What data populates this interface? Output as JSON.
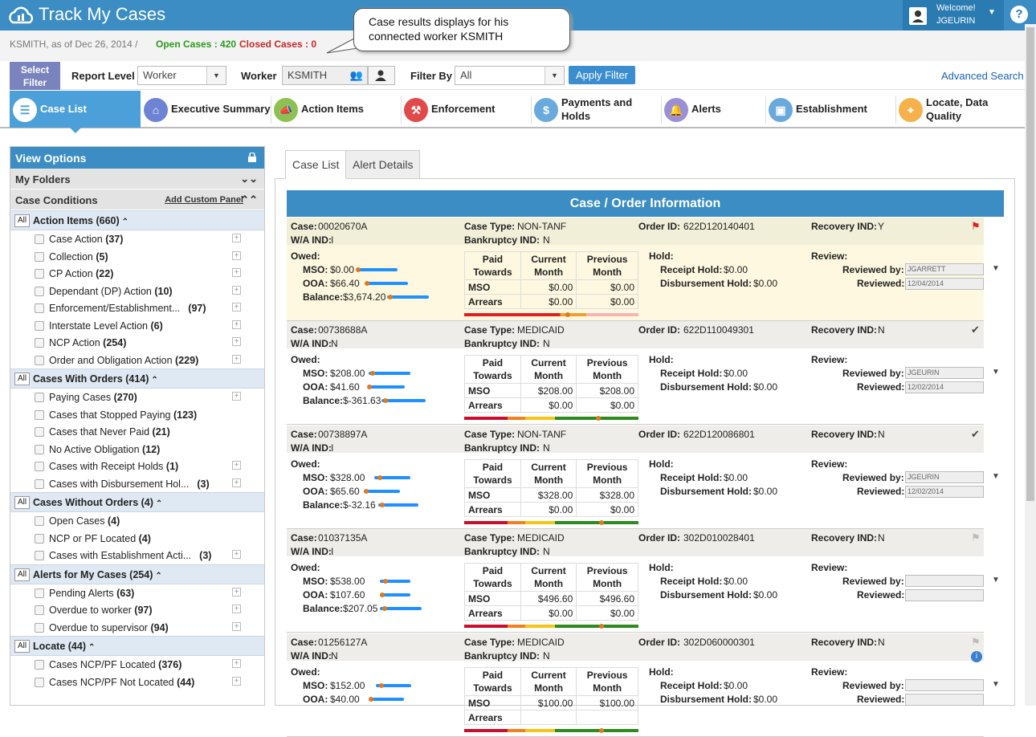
{
  "app": {
    "title": "Track My Cases",
    "welcome": "Welcome!",
    "user": "JGEURIN",
    "help": "?"
  },
  "subheader": {
    "user_date": "KSMITH, as of Dec 26, 2014  /",
    "open_cases": "Open Cases : 420",
    "closed_cases": "Closed Cases : 0"
  },
  "callout": {
    "text": "Case results displays for his connected worker KSMITH"
  },
  "filter": {
    "select_filter": "Select Filter",
    "report_level_label": "Report Level",
    "report_level_value": "Worker",
    "worker_label": "Worker",
    "worker_value": "KSMITH",
    "filter_by_label": "Filter By",
    "filter_by_value": "All",
    "apply": "Apply Filter",
    "advanced": "Advanced Search"
  },
  "nav": {
    "tabs": [
      {
        "label": "Case List",
        "icon": "list-icon"
      },
      {
        "label": "Executive Summary",
        "icon": "home-icon"
      },
      {
        "label": "Action Items",
        "icon": "megaphone-icon"
      },
      {
        "label": "Enforcement",
        "icon": "gavel-icon"
      },
      {
        "label": "Payments and Holds",
        "icon": "money-icon"
      },
      {
        "label": "Alerts",
        "icon": "bell-icon"
      },
      {
        "label": "Establishment",
        "icon": "briefcase-icon"
      },
      {
        "label": "Locate, Data Quality",
        "icon": "location-icon"
      }
    ]
  },
  "left": {
    "view_options": "View Options",
    "my_folders": "My Folders",
    "case_conditions": "Case Conditions",
    "add_custom_panel": "Add Custom Panel",
    "all": "All",
    "groups": [
      {
        "title": "Action Items (660)",
        "items": [
          [
            "Case Action ",
            "(37)"
          ],
          [
            "Collection ",
            "(5)"
          ],
          [
            "CP Action ",
            "(22)"
          ],
          [
            "Dependant (DP) Action ",
            "(10)"
          ],
          [
            "Enforcement/Establishment...",
            "(97)"
          ],
          [
            "Interstate Level Action ",
            "(6)"
          ],
          [
            "NCP Action ",
            "(254)"
          ],
          [
            "Order and Obligation Action ",
            "(229)"
          ]
        ]
      },
      {
        "title": "Cases With Orders (414)",
        "items": [
          [
            "Paying Cases ",
            "(270)"
          ],
          [
            "Cases that Stopped Paying ",
            "(123)"
          ],
          [
            "Cases that Never Paid ",
            "(21)"
          ],
          [
            "No Active Obligation ",
            "(12)"
          ],
          [
            "Cases with Receipt Holds ",
            "(1)"
          ],
          [
            "Cases with Disbursement Hol...",
            "(3)"
          ]
        ]
      },
      {
        "title": "Cases Without Orders (4)",
        "items": [
          [
            "Open Cases ",
            "(4)"
          ],
          [
            "NCP or PF Located ",
            "(4)"
          ],
          [
            "Cases with Establishment Acti...",
            "(3)"
          ]
        ]
      },
      {
        "title": "Alerts for My Cases (254)",
        "items": [
          [
            "Pending Alerts ",
            "(63)"
          ],
          [
            "Overdue to worker ",
            "(97)"
          ],
          [
            "Overdue to supervisor ",
            "(94)"
          ]
        ]
      },
      {
        "title": "Locate (44)",
        "items": [
          [
            "Cases NCP/PF Located ",
            "(376)"
          ],
          [
            "Cases NCP/PF Not Located ",
            "(44)"
          ]
        ]
      }
    ]
  },
  "main": {
    "tabs": [
      "Case List",
      "Alert Details"
    ],
    "section_title": "Case / Order Information",
    "labels": {
      "case": "Case:",
      "wa": "W/A IND:",
      "case_type": "Case Type:",
      "bankruptcy": "Bankruptcy IND:",
      "order": "Order ID:",
      "recovery": "Recovery IND:",
      "owed": "Owed:",
      "mso": "MSO:",
      "ooa": "OOA:",
      "balance": "Balance:",
      "hold": "Hold:",
      "receipt": "Receipt Hold:",
      "disb": "Disbursement Hold:",
      "review": "Review:",
      "reviewed_by": "Reviewed by:",
      "reviewed": "Reviewed:",
      "paid": "Paid Towards",
      "current": "Current Month",
      "previous": "Previous Month",
      "row_mso": "MSO",
      "row_arrears": "Arrears"
    },
    "cases": [
      {
        "case": "00020670A",
        "wa": "I",
        "type": "NON-TANF",
        "bank": "N",
        "order": "622D120140401",
        "recovery": "Y",
        "mso": "$0.00",
        "ooa": "$66.40",
        "balance": "$3,674.20",
        "tbl": [
          [
            "$0.00",
            "$0.00"
          ],
          [
            "$0.00",
            "$0.00"
          ]
        ],
        "receipt": "$0.00",
        "disb": "$0.00",
        "by": "JGARRETT",
        "date": "12/04/2014",
        "status": "flag-red"
      },
      {
        "case": "00738688A",
        "wa": "N",
        "type": "MEDICAID",
        "bank": "N",
        "order": "622D110049301",
        "recovery": "N",
        "mso": "$208.00",
        "ooa": "$41.60",
        "balance": "$-361.63",
        "tbl": [
          [
            "$208.00",
            "$208.00"
          ],
          [
            "$0.00",
            "$0.00"
          ]
        ],
        "receipt": "$0.00",
        "disb": "$0.00",
        "by": "JGEURIN",
        "date": "12/02/2014",
        "status": "check"
      },
      {
        "case": "00738897A",
        "wa": "I",
        "type": "NON-TANF",
        "bank": "N",
        "order": "622D120086801",
        "recovery": "N",
        "mso": "$328.00",
        "ooa": "$65.60",
        "balance": "$-32.16",
        "tbl": [
          [
            "$328.00",
            "$328.00"
          ],
          [
            "$0.00",
            "$0.00"
          ]
        ],
        "receipt": "$0.00",
        "disb": "$0.00",
        "by": "JGEURIN",
        "date": "12/02/2014",
        "status": "check"
      },
      {
        "case": "01037135A",
        "wa": "I",
        "type": "MEDICAID",
        "bank": "N",
        "order": "302D010028401",
        "recovery": "N",
        "mso": "$538.00",
        "ooa": "$107.60",
        "balance": "$207.05",
        "tbl": [
          [
            "$496.60",
            "$496.60"
          ],
          [
            "$0.00",
            "$0.00"
          ]
        ],
        "receipt": "$0.00",
        "disb": "$0.00",
        "by": "",
        "date": "",
        "status": "flag-grey"
      },
      {
        "case": "01256127A",
        "wa": "N",
        "type": "MEDICAID",
        "bank": "N",
        "order": "302D060000301",
        "recovery": "N",
        "mso": "$152.00",
        "ooa": "$40.00",
        "balance": "",
        "tbl": [
          [
            "$100.00",
            "$100.00"
          ],
          [
            "",
            ""
          ]
        ],
        "receipt": "$0.00",
        "disb": "$0.00",
        "by": "",
        "date": "",
        "status": "flag-grey-info"
      }
    ]
  },
  "colors": {
    "brand": "#3b8dc3",
    "open": "#2b9a1a",
    "closed": "#c62828",
    "bar": "#1e90ff"
  }
}
